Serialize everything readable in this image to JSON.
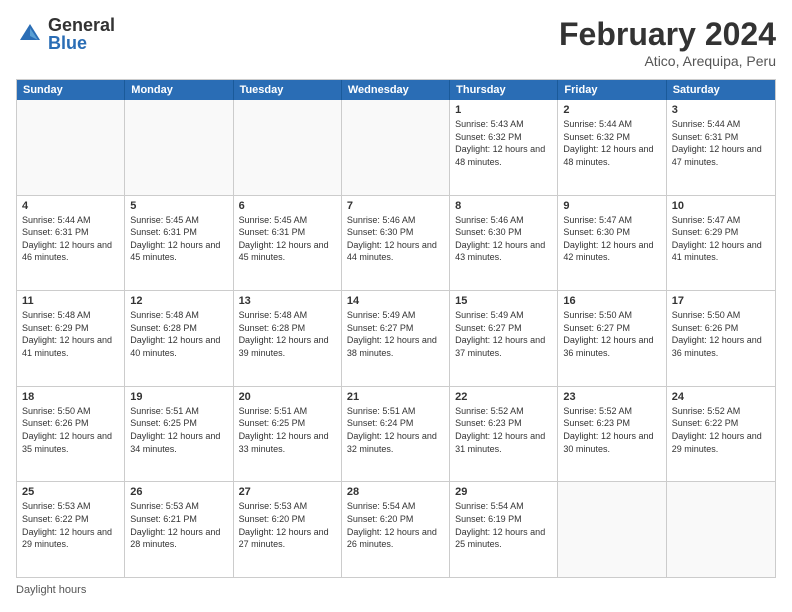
{
  "logo": {
    "general": "General",
    "blue": "Blue"
  },
  "title": {
    "main": "February 2024",
    "sub": "Atico, Arequipa, Peru"
  },
  "calendar": {
    "headers": [
      "Sunday",
      "Monday",
      "Tuesday",
      "Wednesday",
      "Thursday",
      "Friday",
      "Saturday"
    ],
    "rows": [
      [
        {
          "day": "",
          "detail": ""
        },
        {
          "day": "",
          "detail": ""
        },
        {
          "day": "",
          "detail": ""
        },
        {
          "day": "",
          "detail": ""
        },
        {
          "day": "1",
          "detail": "Sunrise: 5:43 AM\nSunset: 6:32 PM\nDaylight: 12 hours and 48 minutes."
        },
        {
          "day": "2",
          "detail": "Sunrise: 5:44 AM\nSunset: 6:32 PM\nDaylight: 12 hours and 48 minutes."
        },
        {
          "day": "3",
          "detail": "Sunrise: 5:44 AM\nSunset: 6:31 PM\nDaylight: 12 hours and 47 minutes."
        }
      ],
      [
        {
          "day": "4",
          "detail": "Sunrise: 5:44 AM\nSunset: 6:31 PM\nDaylight: 12 hours and 46 minutes."
        },
        {
          "day": "5",
          "detail": "Sunrise: 5:45 AM\nSunset: 6:31 PM\nDaylight: 12 hours and 45 minutes."
        },
        {
          "day": "6",
          "detail": "Sunrise: 5:45 AM\nSunset: 6:31 PM\nDaylight: 12 hours and 45 minutes."
        },
        {
          "day": "7",
          "detail": "Sunrise: 5:46 AM\nSunset: 6:30 PM\nDaylight: 12 hours and 44 minutes."
        },
        {
          "day": "8",
          "detail": "Sunrise: 5:46 AM\nSunset: 6:30 PM\nDaylight: 12 hours and 43 minutes."
        },
        {
          "day": "9",
          "detail": "Sunrise: 5:47 AM\nSunset: 6:30 PM\nDaylight: 12 hours and 42 minutes."
        },
        {
          "day": "10",
          "detail": "Sunrise: 5:47 AM\nSunset: 6:29 PM\nDaylight: 12 hours and 41 minutes."
        }
      ],
      [
        {
          "day": "11",
          "detail": "Sunrise: 5:48 AM\nSunset: 6:29 PM\nDaylight: 12 hours and 41 minutes."
        },
        {
          "day": "12",
          "detail": "Sunrise: 5:48 AM\nSunset: 6:28 PM\nDaylight: 12 hours and 40 minutes."
        },
        {
          "day": "13",
          "detail": "Sunrise: 5:48 AM\nSunset: 6:28 PM\nDaylight: 12 hours and 39 minutes."
        },
        {
          "day": "14",
          "detail": "Sunrise: 5:49 AM\nSunset: 6:27 PM\nDaylight: 12 hours and 38 minutes."
        },
        {
          "day": "15",
          "detail": "Sunrise: 5:49 AM\nSunset: 6:27 PM\nDaylight: 12 hours and 37 minutes."
        },
        {
          "day": "16",
          "detail": "Sunrise: 5:50 AM\nSunset: 6:27 PM\nDaylight: 12 hours and 36 minutes."
        },
        {
          "day": "17",
          "detail": "Sunrise: 5:50 AM\nSunset: 6:26 PM\nDaylight: 12 hours and 36 minutes."
        }
      ],
      [
        {
          "day": "18",
          "detail": "Sunrise: 5:50 AM\nSunset: 6:26 PM\nDaylight: 12 hours and 35 minutes."
        },
        {
          "day": "19",
          "detail": "Sunrise: 5:51 AM\nSunset: 6:25 PM\nDaylight: 12 hours and 34 minutes."
        },
        {
          "day": "20",
          "detail": "Sunrise: 5:51 AM\nSunset: 6:25 PM\nDaylight: 12 hours and 33 minutes."
        },
        {
          "day": "21",
          "detail": "Sunrise: 5:51 AM\nSunset: 6:24 PM\nDaylight: 12 hours and 32 minutes."
        },
        {
          "day": "22",
          "detail": "Sunrise: 5:52 AM\nSunset: 6:23 PM\nDaylight: 12 hours and 31 minutes."
        },
        {
          "day": "23",
          "detail": "Sunrise: 5:52 AM\nSunset: 6:23 PM\nDaylight: 12 hours and 30 minutes."
        },
        {
          "day": "24",
          "detail": "Sunrise: 5:52 AM\nSunset: 6:22 PM\nDaylight: 12 hours and 29 minutes."
        }
      ],
      [
        {
          "day": "25",
          "detail": "Sunrise: 5:53 AM\nSunset: 6:22 PM\nDaylight: 12 hours and 29 minutes."
        },
        {
          "day": "26",
          "detail": "Sunrise: 5:53 AM\nSunset: 6:21 PM\nDaylight: 12 hours and 28 minutes."
        },
        {
          "day": "27",
          "detail": "Sunrise: 5:53 AM\nSunset: 6:20 PM\nDaylight: 12 hours and 27 minutes."
        },
        {
          "day": "28",
          "detail": "Sunrise: 5:54 AM\nSunset: 6:20 PM\nDaylight: 12 hours and 26 minutes."
        },
        {
          "day": "29",
          "detail": "Sunrise: 5:54 AM\nSunset: 6:19 PM\nDaylight: 12 hours and 25 minutes."
        },
        {
          "day": "",
          "detail": ""
        },
        {
          "day": "",
          "detail": ""
        }
      ]
    ]
  },
  "footer": {
    "label": "Daylight hours"
  }
}
